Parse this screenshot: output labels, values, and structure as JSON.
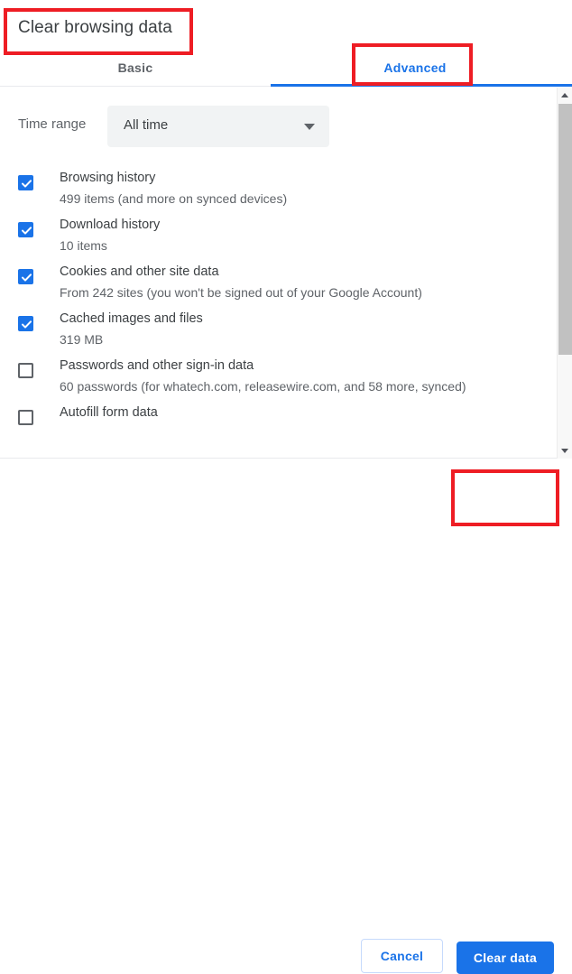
{
  "dialog": {
    "title": "Clear browsing data"
  },
  "tabs": [
    {
      "id": "basic",
      "label": "Basic",
      "selected": false
    },
    {
      "id": "advanced",
      "label": "Advanced",
      "selected": true
    }
  ],
  "time_range": {
    "label": "Time range",
    "value": "All time",
    "arrow_icon": "chevron-down-icon"
  },
  "items": [
    {
      "id": "browsing-history",
      "title": "Browsing history",
      "subtitle": "499 items (and more on synced devices)",
      "checked": true
    },
    {
      "id": "download-history",
      "title": "Download history",
      "subtitle": "10 items",
      "checked": true
    },
    {
      "id": "cookies-and-other-site-data",
      "title": "Cookies and other site data",
      "subtitle": "From 242 sites (you won't be signed out of your Google Account)",
      "checked": true
    },
    {
      "id": "cached-images-and-files",
      "title": "Cached images and files",
      "subtitle": "319 MB",
      "checked": true
    },
    {
      "id": "passwords-and-other-sign-in-data",
      "title": "Passwords and other sign-in data",
      "subtitle": "60 passwords (for whatech.com, releasewire.com, and 58 more, synced)",
      "checked": false
    },
    {
      "id": "autofill-form-data",
      "title": "Autofill form data",
      "subtitle": "",
      "checked": false
    }
  ],
  "footer": {
    "cancel_label": "Cancel",
    "clear_label": "Clear data"
  },
  "scrollbar": {
    "up_icon": "scroll-up-arrow-icon",
    "down_icon": "scroll-down-arrow-icon"
  },
  "colors": {
    "accent": "#1a73e8",
    "annotation": "#ee1d24",
    "text_primary": "#3c4043",
    "text_secondary": "#5f6368",
    "select_bg": "#f1f3f4"
  }
}
